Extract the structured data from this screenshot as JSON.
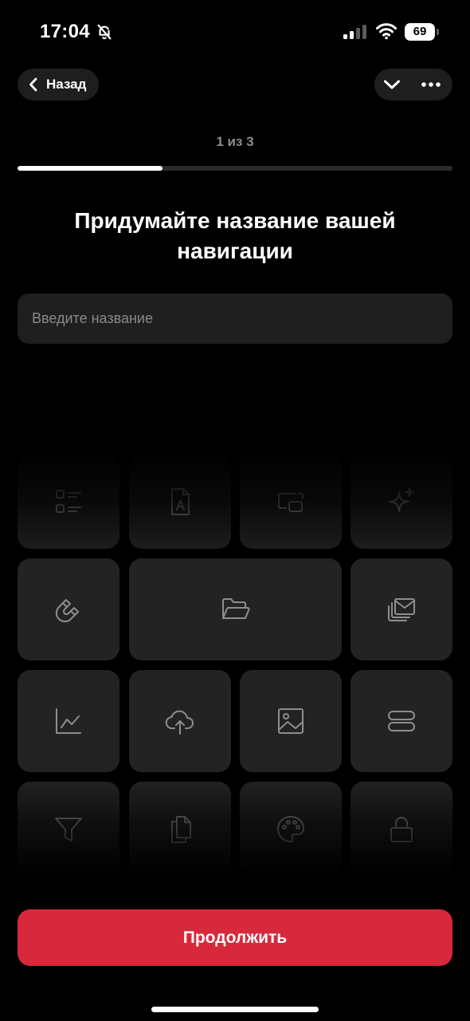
{
  "status_bar": {
    "time": "17:04",
    "battery_level": "69",
    "icons": [
      "bell-slash-icon",
      "cellular-signal-icon",
      "wifi-icon",
      "battery-icon"
    ]
  },
  "nav": {
    "back_label": "Назад",
    "icons": [
      "chevron-left-icon",
      "chevron-down-icon",
      "more-icon"
    ]
  },
  "progress": {
    "step_label": "1 из 3",
    "fraction": 0.333
  },
  "heading": "Придумайте название вашей навигации",
  "name_input": {
    "placeholder": "Введите название",
    "value": ""
  },
  "tiles": [
    {
      "icon": "checklist-icon"
    },
    {
      "icon": "document-a-icon"
    },
    {
      "icon": "screens-icon"
    },
    {
      "icon": "sparkles-icon"
    },
    {
      "icon": "magnet-icon"
    },
    {
      "icon": "folder-icon"
    },
    {
      "icon": "mail-stack-icon"
    },
    {
      "icon": "line-chart-icon"
    },
    {
      "icon": "cloud-upload-icon"
    },
    {
      "icon": "image-icon"
    },
    {
      "icon": "server-icon"
    },
    {
      "icon": "filter-icon"
    },
    {
      "icon": "copy-icon"
    },
    {
      "icon": "palette-icon"
    },
    {
      "icon": "lock-icon"
    }
  ],
  "continue_label": "Продолжить",
  "colors": {
    "background": "#000000",
    "surface": "#1e1e1e",
    "tile": "#232323",
    "accent": "#d7293b",
    "muted_text": "#8b8b8b"
  }
}
